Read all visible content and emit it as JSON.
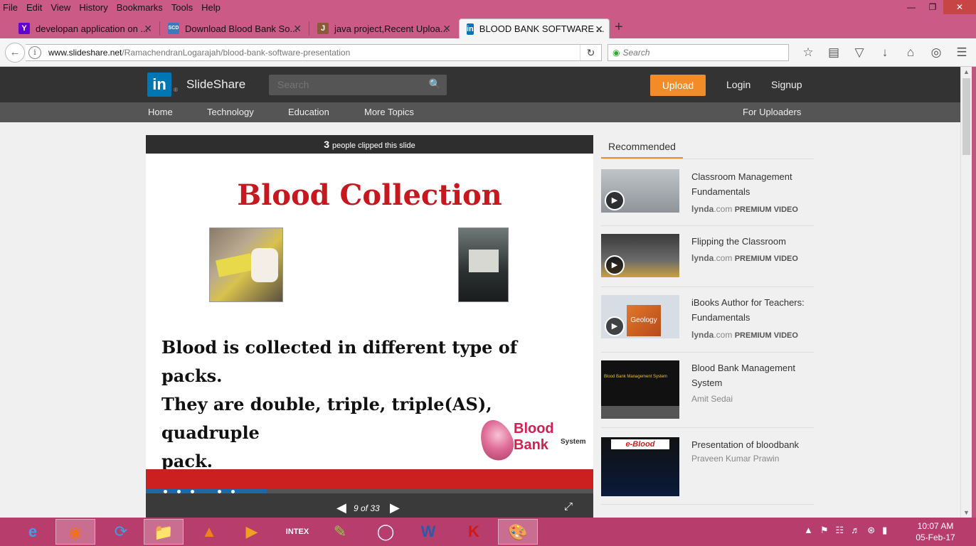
{
  "browser": {
    "menu": [
      "File",
      "Edit",
      "View",
      "History",
      "Bookmarks",
      "Tools",
      "Help"
    ],
    "tabs": [
      {
        "title": "developan application on ...",
        "icon": "Y"
      },
      {
        "title": "Download Blood Bank So...",
        "icon": "SCD"
      },
      {
        "title": "java project,Recent Uploa...",
        "icon": "J"
      },
      {
        "title": "BLOOD BANK SOFTWARE ...",
        "icon": "in"
      }
    ],
    "url_domain": "www.slideshare.net",
    "url_path": "/RamachendranLogarajah/blood-bank-software-presentation",
    "search_placeholder": "Search",
    "accent": "#cc5a86"
  },
  "site": {
    "logo": "in",
    "reg": "®",
    "name": "SlideShare",
    "search_placeholder": "Search",
    "upload": "Upload",
    "login": "Login",
    "signup": "Signup",
    "nav": [
      "Home",
      "Technology",
      "Education",
      "More Topics"
    ],
    "nav_right": "For Uploaders",
    "accent": "#f28c28"
  },
  "player": {
    "clip_count": "3",
    "clip_text": "people clipped this slide",
    "slide_title": "Blood Collection",
    "slide_line1": "Blood is collected in different type of  packs.",
    "slide_line2": "They are double, triple, triple(AS), quadruple",
    "slide_line3": "pack.",
    "logo_text": "Blood Bank",
    "logo_sub": "System",
    "counter": "9 of 33",
    "progress": 0.27
  },
  "recommended": {
    "tab": "Recommended",
    "items": [
      {
        "title": "Classroom Management Fundamentals",
        "source": "lynda",
        "source_suffix": ".com",
        "badge": "PREMIUM VIDEO",
        "video": true
      },
      {
        "title": "Flipping the Classroom",
        "source": "lynda",
        "source_suffix": ".com",
        "badge": "PREMIUM VIDEO",
        "video": true
      },
      {
        "title": "iBooks Author for Teachers: Fundamentals",
        "source": "lynda",
        "source_suffix": ".com",
        "badge": "PREMIUM VIDEO",
        "video": true,
        "thumb_text": "Geology"
      },
      {
        "title": "Blood Bank Management System",
        "author": "Amit Sedai",
        "thumb_text": "Blood Bank Management System"
      },
      {
        "title": "Presentation of bloodbank",
        "author": "Praveen Kumar Prawin",
        "thumb_text": "e-Blood"
      }
    ]
  },
  "taskbar": {
    "tray_app": "INTEX",
    "time": "10:07 AM",
    "date": "05-Feb-17"
  }
}
